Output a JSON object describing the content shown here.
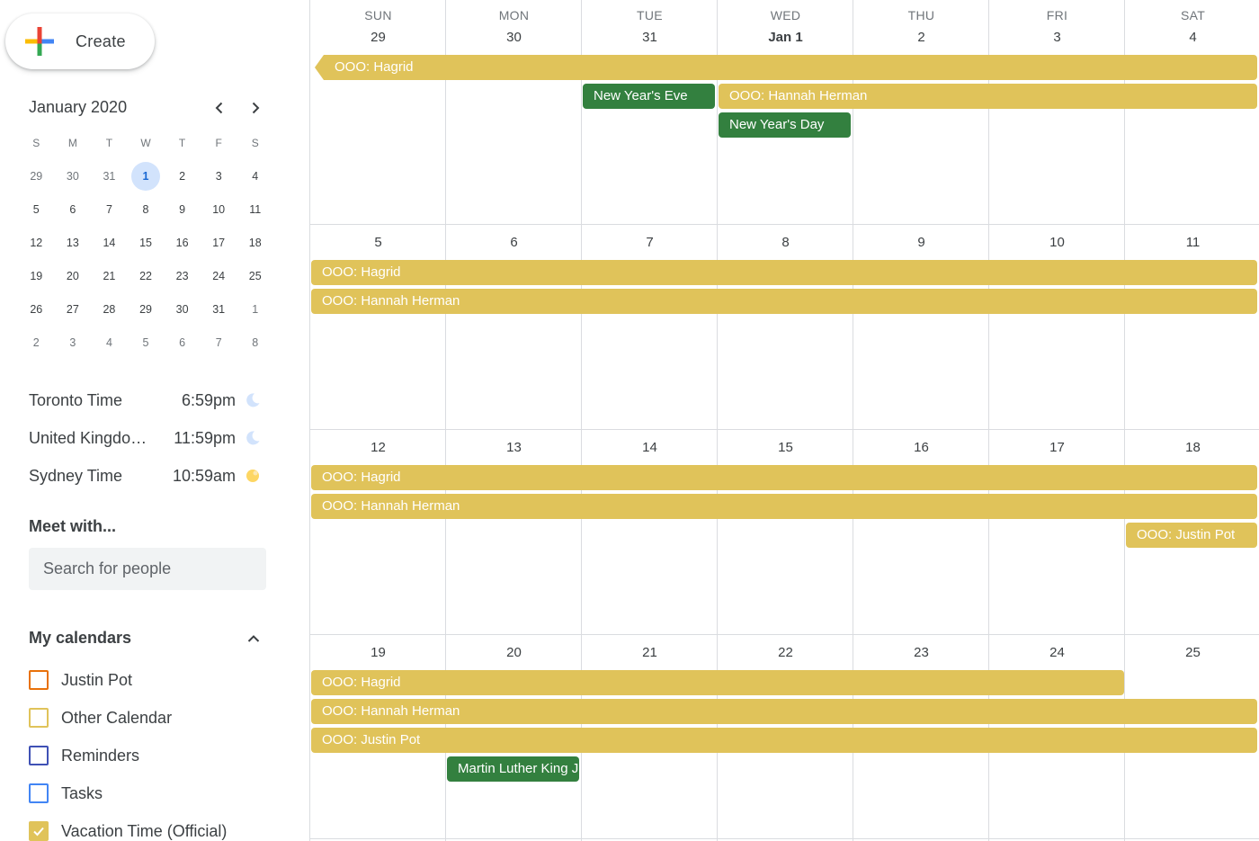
{
  "create": {
    "label": "Create"
  },
  "mini_calendar": {
    "title": "January 2020",
    "weekday_headers": [
      "S",
      "M",
      "T",
      "W",
      "T",
      "F",
      "S"
    ],
    "weeks": [
      [
        "29",
        "30",
        "31",
        "1",
        "2",
        "3",
        "4"
      ],
      [
        "5",
        "6",
        "7",
        "8",
        "9",
        "10",
        "11"
      ],
      [
        "12",
        "13",
        "14",
        "15",
        "16",
        "17",
        "18"
      ],
      [
        "19",
        "20",
        "21",
        "22",
        "23",
        "24",
        "25"
      ],
      [
        "26",
        "27",
        "28",
        "29",
        "30",
        "31",
        "1"
      ],
      [
        "2",
        "3",
        "4",
        "5",
        "6",
        "7",
        "8"
      ]
    ],
    "today": "1"
  },
  "time_zones": [
    {
      "name": "Toronto Time",
      "time": "6:59pm",
      "icon": "moon-icon"
    },
    {
      "name": "United Kingdom Time",
      "time": "11:59pm",
      "icon": "moon-icon"
    },
    {
      "name": "Sydney Time",
      "time": "10:59am",
      "icon": "sun-icon"
    }
  ],
  "meet": {
    "title": "Meet with...",
    "search_placeholder": "Search for people"
  },
  "my_calendars": {
    "title": "My calendars",
    "items": [
      {
        "name": "Justin Pot",
        "color": "#e8710a",
        "checked": false
      },
      {
        "name": "Other Calendar",
        "color": "#e0c35a",
        "checked": false
      },
      {
        "name": "Reminders",
        "color": "#3f51b5",
        "checked": false
      },
      {
        "name": "Tasks",
        "color": "#4285f4",
        "checked": false
      },
      {
        "name": "Vacation Time (Official)",
        "color": "#e0c35a",
        "checked": true
      }
    ]
  },
  "grid": {
    "day_headers": [
      "SUN",
      "MON",
      "TUE",
      "WED",
      "THU",
      "FRI",
      "SAT"
    ],
    "weeks": [
      {
        "days": [
          "29",
          "30",
          "31",
          "Jan 1",
          "2",
          "3",
          "4"
        ],
        "events": [
          {
            "title": "OOO: Hagrid",
            "start": 0,
            "end": 6,
            "row": 0,
            "color": "yellow",
            "continued": true
          },
          {
            "title": "New Year's Eve",
            "start": 2,
            "end": 2,
            "row": 1,
            "color": "green"
          },
          {
            "title": "OOO: Hannah Herman",
            "start": 3,
            "end": 6,
            "row": 1,
            "color": "yellow"
          },
          {
            "title": "New Year's Day",
            "start": 3,
            "end": 3,
            "row": 2,
            "color": "green"
          }
        ]
      },
      {
        "days": [
          "5",
          "6",
          "7",
          "8",
          "9",
          "10",
          "11"
        ],
        "events": [
          {
            "title": "OOO: Hagrid",
            "start": 0,
            "end": 6,
            "row": 0,
            "color": "yellow"
          },
          {
            "title": "OOO: Hannah Herman",
            "start": 0,
            "end": 6,
            "row": 1,
            "color": "yellow"
          }
        ]
      },
      {
        "days": [
          "12",
          "13",
          "14",
          "15",
          "16",
          "17",
          "18"
        ],
        "events": [
          {
            "title": "OOO: Hagrid",
            "start": 0,
            "end": 6,
            "row": 0,
            "color": "yellow"
          },
          {
            "title": "OOO: Hannah Herman",
            "start": 0,
            "end": 6,
            "row": 1,
            "color": "yellow"
          },
          {
            "title": "OOO: Justin Pot",
            "start": 6,
            "end": 6,
            "row": 2,
            "color": "yellow"
          }
        ]
      },
      {
        "days": [
          "19",
          "20",
          "21",
          "22",
          "23",
          "24",
          "25"
        ],
        "events": [
          {
            "title": "OOO: Hagrid",
            "start": 0,
            "end": 5,
            "row": 0,
            "color": "yellow"
          },
          {
            "title": "OOO: Hannah Herman",
            "start": 0,
            "end": 6,
            "row": 1,
            "color": "yellow"
          },
          {
            "title": "OOO: Justin Pot",
            "start": 0,
            "end": 6,
            "row": 2,
            "color": "yellow"
          },
          {
            "title": "Martin Luther King Jr. Day",
            "start": 1,
            "end": 1,
            "row": 3,
            "color": "green"
          }
        ]
      }
    ]
  }
}
